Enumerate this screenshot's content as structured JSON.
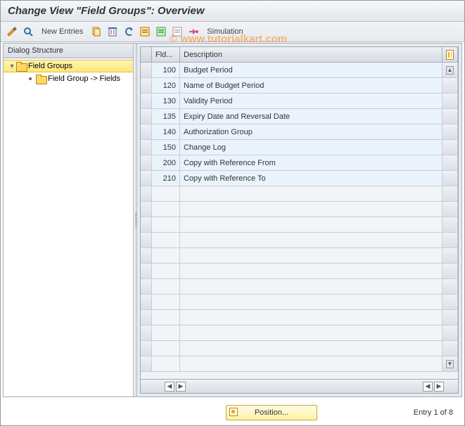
{
  "title": "Change View \"Field Groups\": Overview",
  "toolbar": {
    "new_entries": "New Entries",
    "simulation": "Simulation"
  },
  "tree": {
    "header": "Dialog Structure",
    "root": "Field Groups",
    "child": "Field Group -> Fields"
  },
  "table": {
    "col_fld": "Fld...",
    "col_desc": "Description",
    "rows": [
      {
        "fld": "100",
        "desc": "Budget Period"
      },
      {
        "fld": "120",
        "desc": "Name of Budget Period"
      },
      {
        "fld": "130",
        "desc": "Validity Period"
      },
      {
        "fld": "135",
        "desc": "Expiry Date and Reversal Date"
      },
      {
        "fld": "140",
        "desc": "Authorization Group"
      },
      {
        "fld": "150",
        "desc": "Change Log"
      },
      {
        "fld": "200",
        "desc": "Copy with Reference From"
      },
      {
        "fld": "210",
        "desc": "Copy with Reference To"
      }
    ],
    "empty_rows": 12
  },
  "footer": {
    "position": "Position...",
    "entry_text": "Entry 1 of 8"
  },
  "watermark": "© www.tutorialkart.com"
}
